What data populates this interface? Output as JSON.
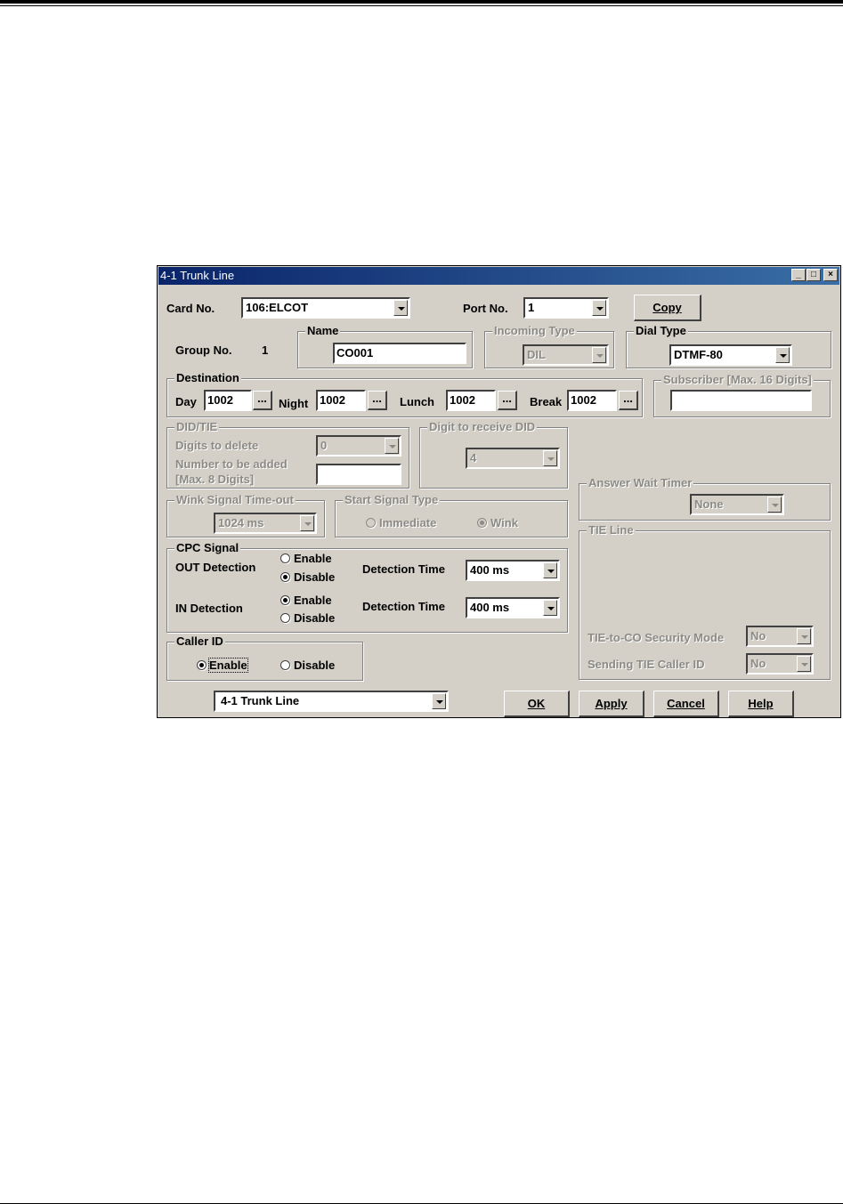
{
  "window": {
    "title": "4-1 Trunk Line"
  },
  "top": {
    "card_no_label": "Card No.",
    "card_no_value": "106:ELCOT",
    "port_no_label": "Port No.",
    "port_no_value": "1",
    "copy_label": "Copy",
    "group_no_label": "Group No.",
    "group_no_value": "1"
  },
  "name": {
    "legend": "Name",
    "value": "CO001"
  },
  "incoming_type": {
    "legend": "Incoming Type",
    "value": "DIL"
  },
  "dial_type": {
    "legend": "Dial Type",
    "value": "DTMF-80"
  },
  "destination": {
    "legend": "Destination",
    "day_label": "Day",
    "day_value": "1002",
    "night_label": "Night",
    "night_value": "1002",
    "lunch_label": "Lunch",
    "lunch_value": "1002",
    "break_label": "Break",
    "break_value": "1002",
    "browse_label": "..."
  },
  "subscriber": {
    "legend": "Subscriber [Max. 16 Digits]",
    "value": ""
  },
  "did_tie": {
    "legend": "DID/TIE",
    "digits_delete_label": "Digits to delete",
    "digits_delete_value": "0",
    "number_added_label": "Number to be added",
    "number_added_label2": "[Max. 8 Digits]",
    "number_added_value": ""
  },
  "digit_receive": {
    "legend": "Digit to receive DID",
    "value": "4"
  },
  "answer_wait": {
    "legend": "Answer Wait Timer",
    "value": "None"
  },
  "wink": {
    "legend": "Wink Signal Time-out",
    "value": "1024 ms"
  },
  "start_signal": {
    "legend": "Start Signal Type",
    "immediate": "Immediate",
    "wink": "Wink"
  },
  "cpc": {
    "legend": "CPC Signal",
    "out_label": "OUT Detection",
    "in_label": "IN Detection",
    "enable": "Enable",
    "disable": "Disable",
    "time_label": "Detection Time",
    "out_time": "400  ms",
    "in_time": "400  ms"
  },
  "caller_id": {
    "legend": "Caller ID",
    "enable": "Enable",
    "disable": "Disable"
  },
  "tie_line": {
    "legend": "TIE Line",
    "security_label": "TIE-to-CO Security Mode",
    "security_value": "No",
    "sending_label": "Sending TIE Caller ID",
    "sending_value": "No"
  },
  "bottom": {
    "nav_value": "4-1 Trunk Line",
    "ok": "OK",
    "apply": "Apply",
    "cancel": "Cancel",
    "help": "Help"
  }
}
